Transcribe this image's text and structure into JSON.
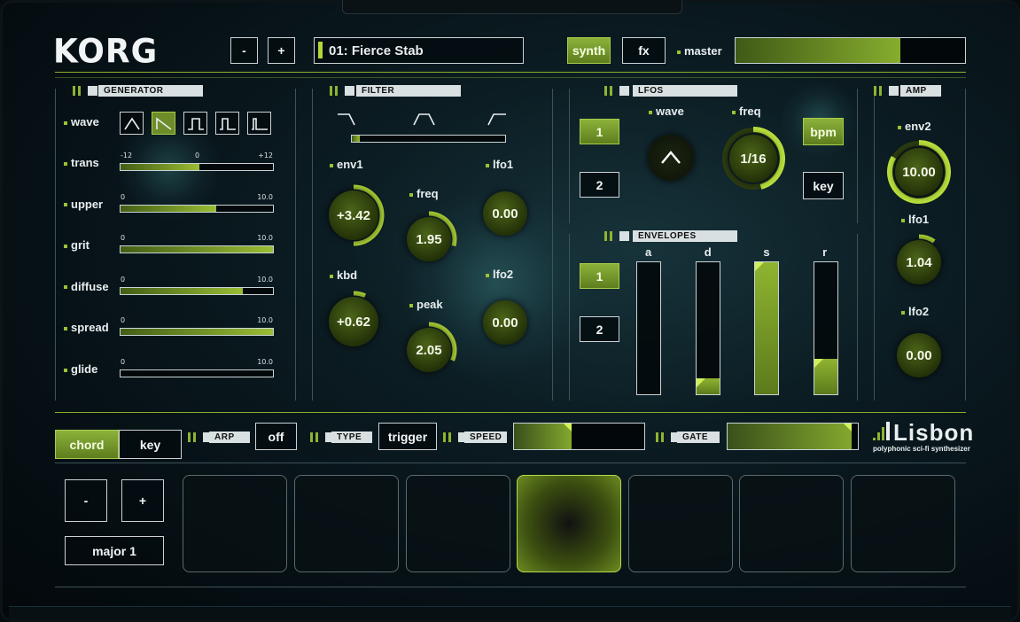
{
  "brand": "KORG",
  "header": {
    "prev_label": "-",
    "next_label": "+",
    "preset": "01: Fierce Stab",
    "synth_label": "synth",
    "fx_label": "fx",
    "master_label": "master",
    "master_level": 0.72
  },
  "generator": {
    "title": "GENERATOR",
    "wave_label": "wave",
    "waveforms": [
      "triangle-icon",
      "saw-icon",
      "square-icon",
      "pulse-icon",
      "narrow-pulse-icon"
    ],
    "selected_wave": 1,
    "params": [
      {
        "label": "trans",
        "min": "-12",
        "mid": "0",
        "max": "+12",
        "value": 0.52
      },
      {
        "label": "upper",
        "min": "0",
        "max": "10.0",
        "value": 0.63
      },
      {
        "label": "grit",
        "min": "0",
        "max": "10.0",
        "value": 1.0
      },
      {
        "label": "diffuse",
        "min": "0",
        "max": "10.0",
        "value": 0.8
      },
      {
        "label": "spread",
        "min": "0",
        "max": "10.0",
        "value": 1.0
      },
      {
        "label": "glide",
        "min": "0",
        "max": "10.0",
        "value": 0.0
      }
    ]
  },
  "filter": {
    "title": "FILTER",
    "types": [
      "lowpass-icon",
      "bandpass-icon",
      "highpass-icon"
    ],
    "type_position": 0.05,
    "env1_label": "env1",
    "env1_value": "+3.42",
    "freq_label": "freq",
    "freq_value": "1.95",
    "lfo1_label": "lfo1",
    "lfo1_value": "0.00",
    "kbd_label": "kbd",
    "kbd_value": "+0.62",
    "peak_label": "peak",
    "peak_value": "2.05",
    "lfo2_label": "lfo2",
    "lfo2_value": "0.00"
  },
  "lfos": {
    "title": "LFOS",
    "btn1": "1",
    "btn2": "2",
    "wave_label": "wave",
    "freq_label": "freq",
    "freq_value": "1/16",
    "bpm_label": "bpm",
    "key_label": "key"
  },
  "envelopes": {
    "title": "ENVELOPES",
    "btn1": "1",
    "btn2": "2",
    "sliders": [
      {
        "label": "a",
        "value": 0.0
      },
      {
        "label": "d",
        "value": 0.12
      },
      {
        "label": "s",
        "value": 1.0
      },
      {
        "label": "r",
        "value": 0.27
      }
    ]
  },
  "amp": {
    "title": "AMP",
    "env2_label": "env2",
    "env2_value": "10.00",
    "lfo1_label": "lfo1",
    "lfo1_value": "1.04",
    "lfo2_label": "lfo2",
    "lfo2_value": "0.00"
  },
  "perform": {
    "chord_label": "chord",
    "key_label": "key",
    "arp_title": "ARP",
    "arp_value": "off",
    "type_title": "TYPE",
    "type_value": "trigger",
    "speed_title": "SPEED",
    "speed_value": 0.44,
    "gate_title": "GATE",
    "gate_value": 0.95,
    "octave_down": "-",
    "octave_up": "+",
    "scale": "major 1",
    "active_pad": 3
  },
  "product": {
    "name": "Lisbon",
    "tagline": "polyphonic sci-fi synthesizer"
  },
  "colors": {
    "accent": "#9cc232",
    "accent_bright": "#d3f25a",
    "background": "#0b1c22"
  }
}
